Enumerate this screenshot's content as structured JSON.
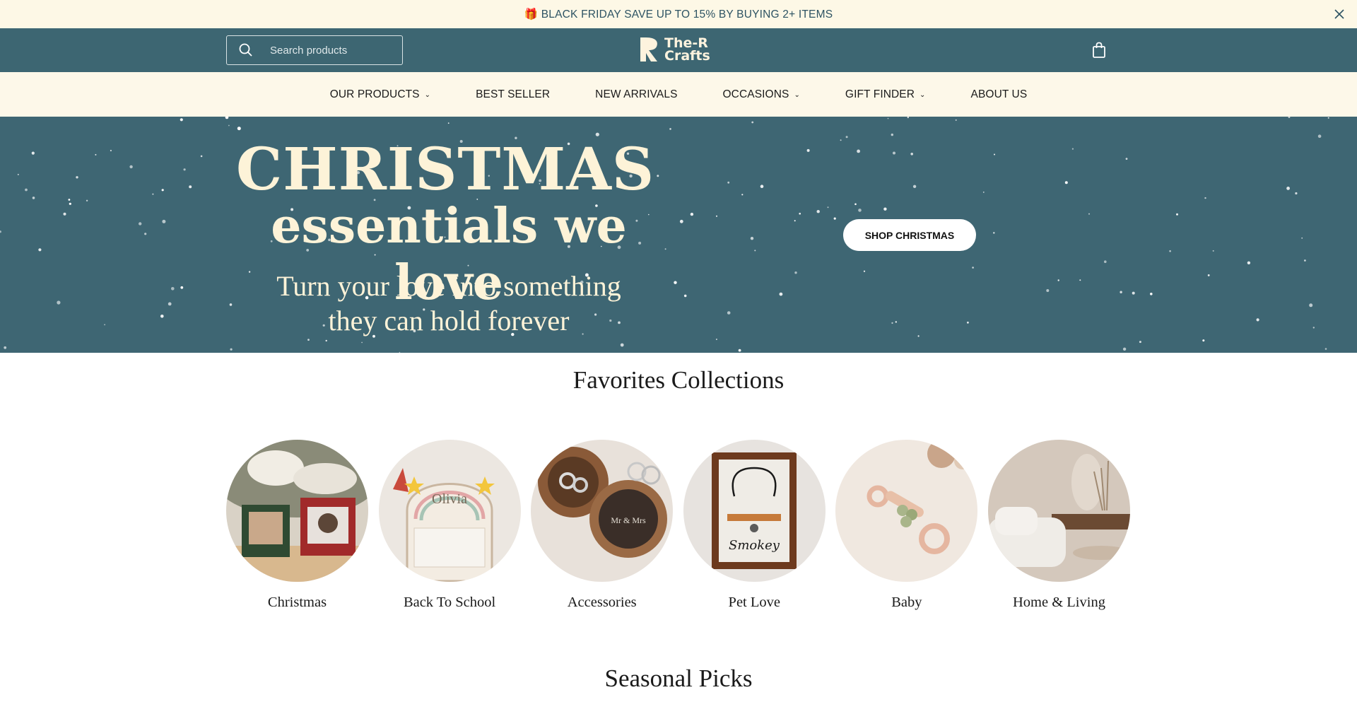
{
  "announcement": {
    "text": "🎁 BLACK FRIDAY SAVE UP TO 15% BY BUYING 2+ ITEMS",
    "close_icon": "close-icon"
  },
  "header": {
    "search_placeholder": "Search products",
    "search_icon": "search-icon",
    "logo_line1": "The-R",
    "logo_line2": "Crafts",
    "cart_icon": "shopping-bag-icon"
  },
  "nav": {
    "items": [
      {
        "label": "OUR PRODUCTS",
        "dropdown": true
      },
      {
        "label": "BEST SELLER",
        "dropdown": false
      },
      {
        "label": "NEW ARRIVALS",
        "dropdown": false
      },
      {
        "label": "OCCASIONS",
        "dropdown": true
      },
      {
        "label": "GIFT FINDER",
        "dropdown": true
      },
      {
        "label": "ABOUT US",
        "dropdown": false
      }
    ]
  },
  "hero": {
    "title_line1": "CHRISTMAS",
    "title_line2": "essentials we love",
    "subtitle_line1": "Turn your love into something",
    "subtitle_line2": "they can hold forever",
    "button_label": "SHOP CHRISTMAS"
  },
  "favorites": {
    "title": "Favorites Collections",
    "items": [
      {
        "label": "Christmas"
      },
      {
        "label": "Back To School"
      },
      {
        "label": "Accessories"
      },
      {
        "label": "Pet Love"
      },
      {
        "label": "Baby"
      },
      {
        "label": "Home & Living"
      }
    ]
  },
  "seasonal": {
    "title": "Seasonal Picks"
  },
  "colors": {
    "teal": "#3e6673",
    "cream": "#fdf8e9",
    "hero_text": "#fdf3d8"
  }
}
